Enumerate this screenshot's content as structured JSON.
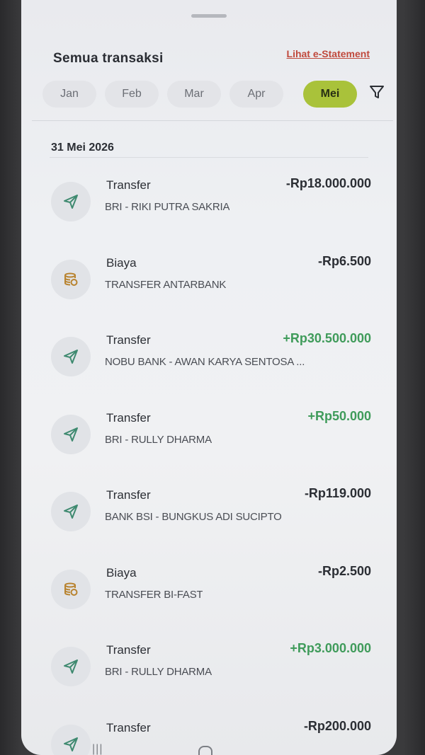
{
  "header": {
    "title": "Semua transaksi",
    "estatement_link": "Lihat e-Statement"
  },
  "months": [
    "Jan",
    "Feb",
    "Mar",
    "Apr",
    "Mei"
  ],
  "active_month": "Mei",
  "date_group": "31 Mei 2026",
  "colors": {
    "accent": "#a9c23a",
    "credit": "#3f9b5a",
    "debit": "#2b2e34",
    "link": "#c0493c",
    "icon_transfer": "#3f8a70",
    "icon_fee": "#b8832f"
  },
  "transactions": [
    {
      "type": "Transfer",
      "desc": "BRI - RIKI PUTRA SAKRIA",
      "amount": "-Rp18.000.000",
      "direction": "debit",
      "icon": "send-icon"
    },
    {
      "type": "Biaya",
      "desc": "TRANSFER ANTARBANK",
      "amount": "-Rp6.500",
      "direction": "debit",
      "icon": "coins-icon"
    },
    {
      "type": "Transfer",
      "desc": "NOBU BANK - AWAN KARYA SENTOSA ...",
      "amount": "+Rp30.500.000",
      "direction": "credit",
      "icon": "send-icon"
    },
    {
      "type": "Transfer",
      "desc": "BRI - RULLY DHARMA",
      "amount": "+Rp50.000",
      "direction": "credit",
      "icon": "send-icon"
    },
    {
      "type": "Transfer",
      "desc": "BANK BSI - BUNGKUS ADI SUCIPTO",
      "amount": "-Rp119.000",
      "direction": "debit",
      "icon": "send-icon"
    },
    {
      "type": "Biaya",
      "desc": "TRANSFER BI-FAST",
      "amount": "-Rp2.500",
      "direction": "debit",
      "icon": "coins-icon"
    },
    {
      "type": "Transfer",
      "desc": "BRI - RULLY DHARMA",
      "amount": "+Rp3.000.000",
      "direction": "credit",
      "icon": "send-icon"
    },
    {
      "type": "Transfer",
      "desc": "",
      "amount": "-Rp200.000",
      "direction": "debit",
      "icon": "send-icon"
    }
  ]
}
